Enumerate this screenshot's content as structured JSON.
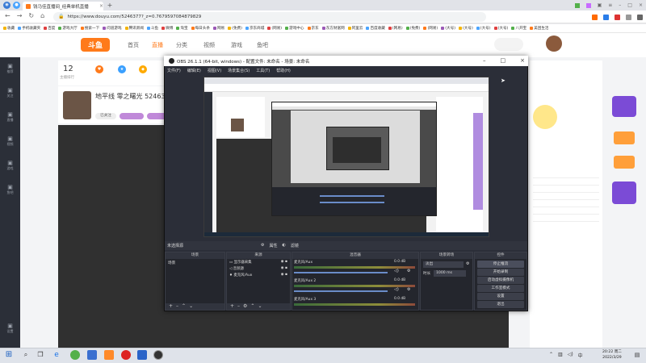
{
  "browser": {
    "tab_title": "钱马佳直播间_经典单机直播",
    "url": "https://www.douyu.com/5246377?_z=0.7679597084879829",
    "url_host": "www.douyu.com"
  },
  "bookmarks": [
    "收藏",
    "手机收藏夹",
    "百度",
    "游戏大厅",
    "搜索一下",
    "问道游戏",
    "腾讯新闻",
    "斗鱼",
    "微博",
    "淘宝",
    "每日头条",
    "网易",
    "(免费)",
    "京东商城",
    "(网易)",
    "游戏中心",
    "京东",
    "东方财富网",
    "阿里云",
    "百度收藏",
    "(网易)",
    "(免费)",
    "(网易)",
    "(大号)",
    "(大号)",
    "(大号)",
    "(大号)",
    "八开宝",
    "美团生活"
  ],
  "douyu": {
    "logo": "斗鱼",
    "nav": [
      "首页",
      "直播",
      "分类",
      "视频",
      "游戏",
      "鱼吧"
    ],
    "stats": [
      {
        "value": "12",
        "label": "主播排行"
      },
      {
        "label": "关注"
      },
      {
        "label": "粉丝"
      }
    ],
    "anchor_name": "地平线 零之曙光",
    "room_id": "524637",
    "follow_label": "已关注",
    "rail_items": [
      "推荐",
      "关注",
      "直播",
      "视频",
      "游戏",
      "鱼吧",
      "设置"
    ]
  },
  "obs": {
    "title": "OBS 26.1.1 (64-bit, windows) - 配置文件: 未命名 - 场景: 未命名",
    "menu": [
      "文件(F)",
      "编辑(E)",
      "视图(V)",
      "场景集合(S)",
      "工具(T)",
      "帮助(H)"
    ],
    "statusbar": {
      "source_label": "未选择源",
      "properties": "属性",
      "filters": "滤镜"
    },
    "docks": {
      "scenes": {
        "header": "场景",
        "items": [
          "场景"
        ]
      },
      "sources": {
        "header": "来源",
        "items": [
          "显示器采集",
          "音频源",
          "麦克风/Aux"
        ]
      },
      "mixer": {
        "header": "混音器",
        "channels": [
          {
            "name": "麦克风/Aux",
            "db": "0.0 dB"
          },
          {
            "name": "麦克风/Aux 2",
            "db": "0.0 dB"
          },
          {
            "name": "麦克风/Aux 3",
            "db": "0.0 dB"
          }
        ]
      },
      "transitions": {
        "header": "场景转场",
        "type": "淡出",
        "duration_label": "时长",
        "duration_value": "1000 ms"
      },
      "controls": {
        "header": "控件",
        "buttons": [
          "停止推流",
          "开始录制",
          "启动虚拟摄像机",
          "工作室模式",
          "设置",
          "退出"
        ]
      }
    }
  },
  "taskbar": {
    "time": "20:22 周二",
    "date": "2022/3/29"
  },
  "colors": {
    "douyu_orange": "#ff7a1a",
    "obs_bg": "#2b2e38",
    "rail": "#2b2f38"
  }
}
